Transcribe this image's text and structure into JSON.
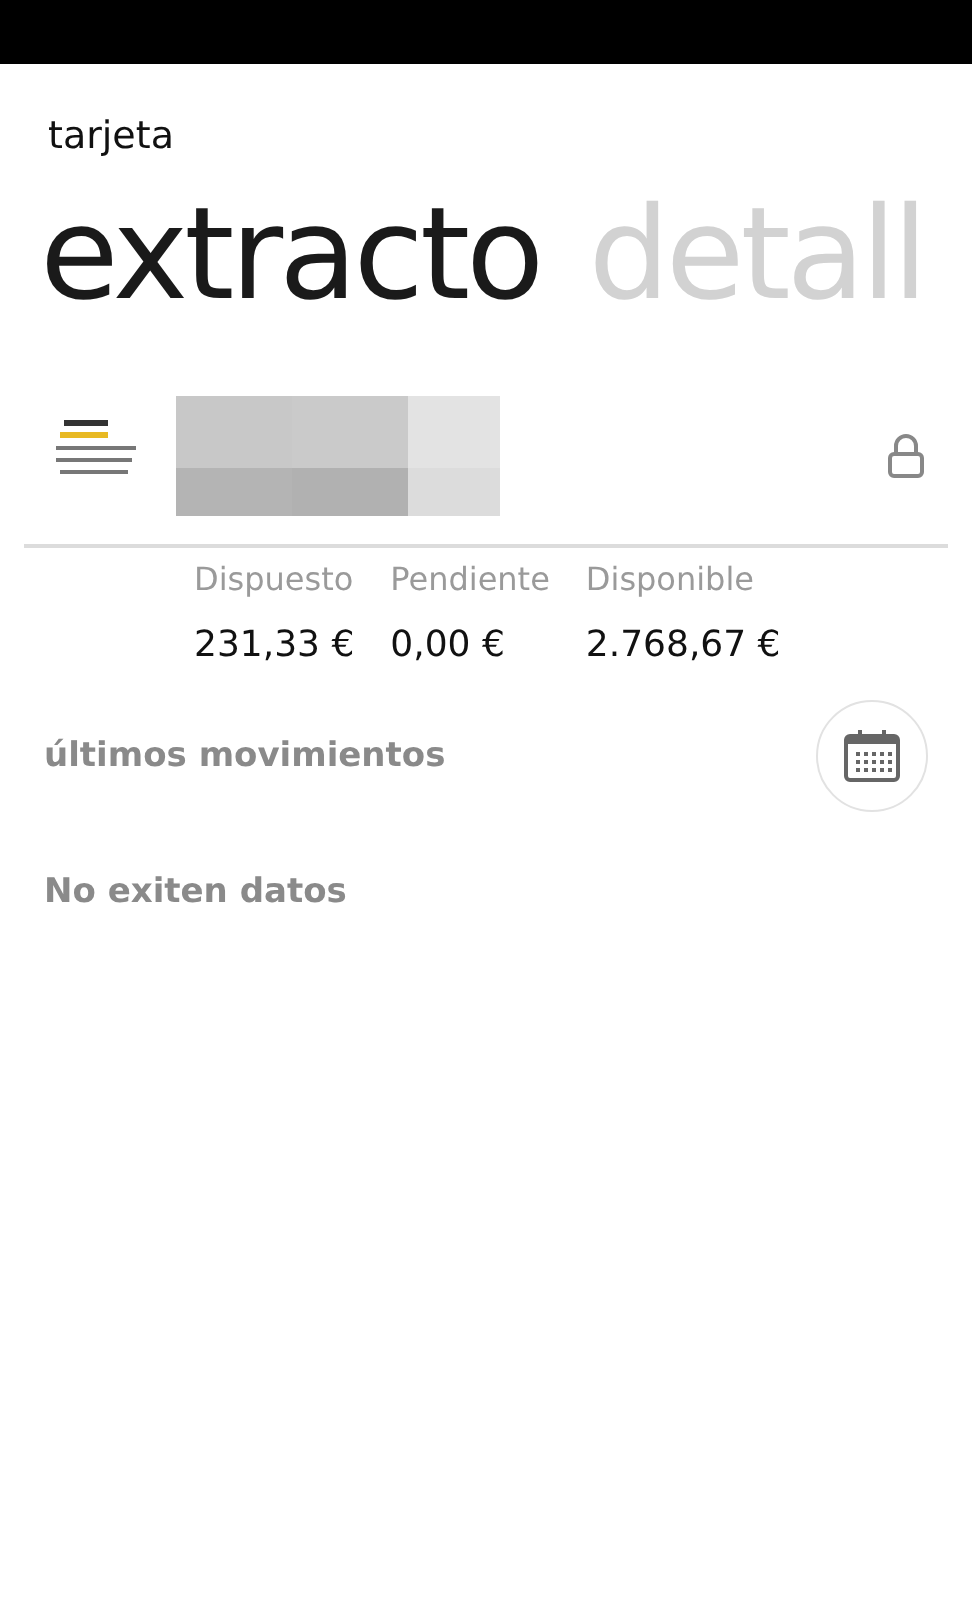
{
  "app_title": "tarjeta",
  "pivots": [
    {
      "label": "extracto",
      "selected": true
    },
    {
      "label": "detall",
      "selected": false
    }
  ],
  "card": {
    "kind": "picture",
    "locked": true
  },
  "balances": [
    {
      "label": "Dispuesto",
      "value": "231,33 €"
    },
    {
      "label": "Pendiente",
      "value": "0,00 €"
    },
    {
      "label": "Disponible",
      "value": "2.768,67 €"
    }
  ],
  "movements": {
    "title": "últimos movimientos",
    "empty_message": "No exiten datos"
  }
}
